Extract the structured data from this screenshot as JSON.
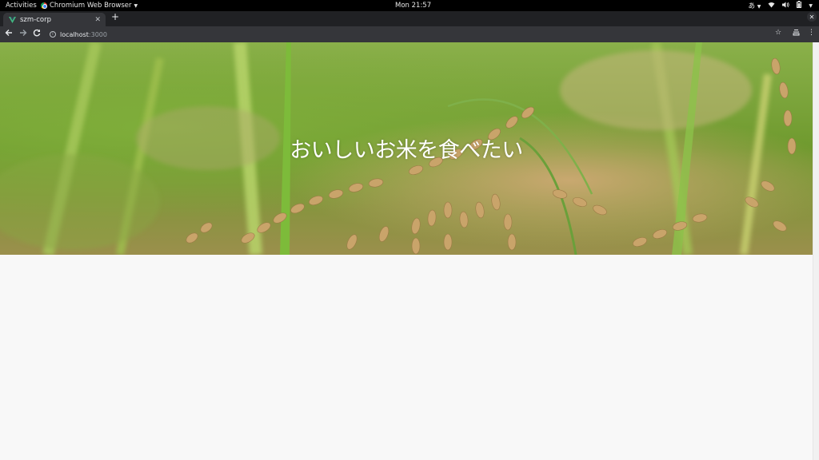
{
  "system_bar": {
    "activities": "Activities",
    "app_name": "Chromium Web Browser",
    "clock": "Mon 21:57",
    "input_method": "あ"
  },
  "browser": {
    "tab_title": "szm-corp",
    "url_host": "localhost",
    "url_port": ":3000"
  },
  "hero": {
    "title": "おいしいお米を食べたい"
  },
  "colors": {
    "titlebar": "#000000",
    "tabbar": "#202124",
    "toolbar": "#35363a",
    "page_background": "#f8f8f8"
  }
}
